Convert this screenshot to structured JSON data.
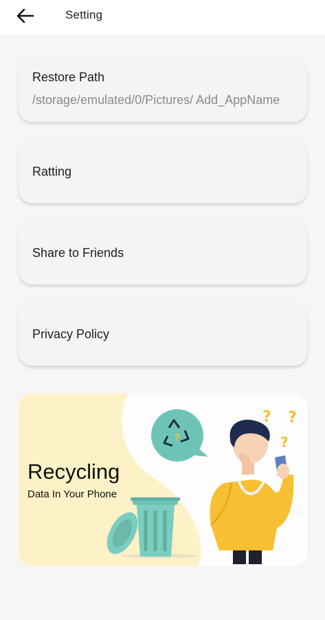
{
  "header": {
    "title": "Setting",
    "back_icon": "arrow-left-icon"
  },
  "settings": {
    "restore_path": {
      "label": "Restore Path",
      "value": "/storage/emulated/0/Pictures/ Add_AppName"
    },
    "rating": {
      "label": "Ratting"
    },
    "share": {
      "label": "Share to Friends"
    },
    "privacy": {
      "label": "Privacy Policy"
    }
  },
  "banner": {
    "title": "Recycling",
    "subtitle": "Data In Your Phone",
    "icons": [
      "recycle-icon",
      "trash-bin-icon",
      "question-mark-icon"
    ],
    "colors": {
      "background": "#fdf1c7",
      "accent_teal": "#6ec3b7",
      "shirt_yellow": "#f7c033",
      "hair": "#1e2b4f"
    }
  }
}
